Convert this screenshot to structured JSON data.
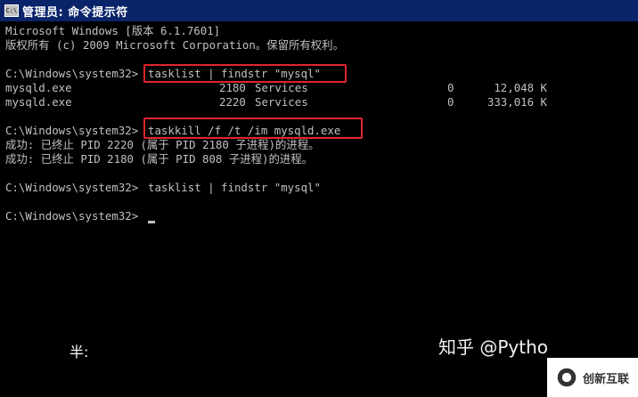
{
  "window": {
    "title": "管理员: 命令提示符",
    "icon": "cmd-icon"
  },
  "console": {
    "header_line1": "Microsoft Windows [版本 6.1.7601]",
    "header_line2": "版权所有 (c) 2009 Microsoft Corporation。保留所有权利。",
    "prompt": "C:\\Windows\\system32>",
    "cmd1": "tasklist | findstr \"mysql\"",
    "process_rows": [
      {
        "name": "mysqld.exe",
        "pid": "2180",
        "session": "Services",
        "num": "0",
        "mem": "12,048 K"
      },
      {
        "name": "mysqld.exe",
        "pid": "2220",
        "session": "Services",
        "num": "0",
        "mem": "333,016 K"
      }
    ],
    "cmd2": "taskkill /f /t /im mysqld.exe",
    "result1": "成功: 已终止 PID 2220 (属于 PID 2180 子进程)的进程。",
    "result2": "成功: 已终止 PID 2180 (属于 PID 808 子进程)的进程。",
    "cmd3": "tasklist | findstr \"mysql\"",
    "highlight_color": "#e0252a",
    "text_color": "#c0c0c0",
    "background_color": "#000000"
  },
  "ime": {
    "indicator": "半:"
  },
  "watermark": {
    "zhihu": "知乎 @Pytho",
    "badge_text": "创新互联"
  }
}
